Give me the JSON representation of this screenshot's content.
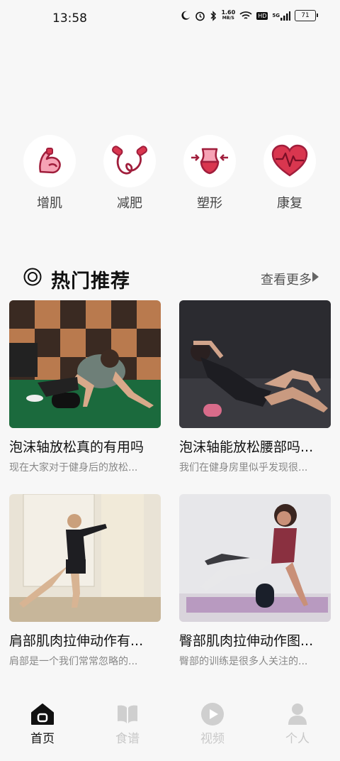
{
  "status": {
    "time": "13:58",
    "net_speed_value": "1.60",
    "net_speed_unit": "MB/S",
    "hd_label": "HD",
    "signal_label": "5G",
    "battery": "71",
    "icons": [
      "moon-icon",
      "alarm-icon",
      "bluetooth-icon",
      "wifi-icon",
      "signal-icon"
    ]
  },
  "categories": [
    {
      "label": "增肌",
      "icon": "muscle-icon"
    },
    {
      "label": "减肥",
      "icon": "jump-rope-icon"
    },
    {
      "label": "塑形",
      "icon": "waist-icon"
    },
    {
      "label": "康复",
      "icon": "heart-icon"
    }
  ],
  "section": {
    "title": "热门推荐",
    "more": "查看更多"
  },
  "cards": [
    {
      "title": "泡沫轴放松真的有用吗",
      "desc": "现在大家对于健身后的放松..."
    },
    {
      "title": "泡沫轴能放松腰部吗...",
      "desc": "我们在健身房里似乎发现很..."
    },
    {
      "title": "肩部肌肉拉伸动作有...",
      "desc": "肩部是一个我们常常忽略的..."
    },
    {
      "title": "臀部肌肉拉伸动作图...",
      "desc": "臀部的训练是很多人关注的..."
    }
  ],
  "tabs": [
    {
      "label": "首页",
      "icon": "home-icon",
      "active": true
    },
    {
      "label": "食谱",
      "icon": "book-icon",
      "active": false
    },
    {
      "label": "视频",
      "icon": "play-icon",
      "active": false
    },
    {
      "label": "个人",
      "icon": "person-icon",
      "active": false
    }
  ],
  "colors": {
    "accent": "#d9364f",
    "accent_light": "#f6a3b5",
    "inactive": "#c8c8c8",
    "text": "#111111"
  }
}
